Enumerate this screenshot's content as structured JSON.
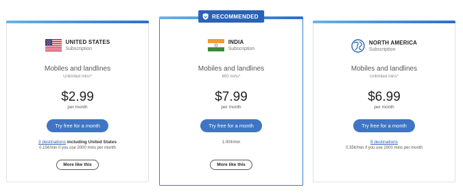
{
  "colors": {
    "accent": "#2a63b5",
    "button": "#3f75c4",
    "featured_border": "#2f7bd6"
  },
  "cards": [
    {
      "country": "UNITED STATES",
      "subtitle": "Subscription",
      "icon": "us-flag-icon",
      "lines": "Mobiles and landlines",
      "mins": "Unlimited mins*",
      "price": "$2.99",
      "per": "per month",
      "try_label": "Try free for a month",
      "dest_link": "3 destinations",
      "dest_suffix": " including United States",
      "rate": "0.15¢/min if you use 2000 mins per month",
      "more_label": "More like this"
    },
    {
      "badge": "RECOMMENDED",
      "country": "INDIA",
      "subtitle": "Subscription",
      "icon": "india-flag-icon",
      "lines": "Mobiles and landlines",
      "mins": "800 mins*",
      "price": "$7.99",
      "per": "per month",
      "try_label": "Try free for a month",
      "rate": "1.00¢/min",
      "more_label": "More like this"
    },
    {
      "country": "NORTH AMERICA",
      "subtitle": "Subscription",
      "icon": "globe-icon",
      "lines": "Mobiles and landlines",
      "mins": "Unlimited mins*",
      "price": "$6.99",
      "per": "per month",
      "try_label": "Try free for a month",
      "dest_link": "8 destinations",
      "rate": "0.35¢/min if you use 2000 mins per month",
      "more_label": "More like this"
    }
  ]
}
